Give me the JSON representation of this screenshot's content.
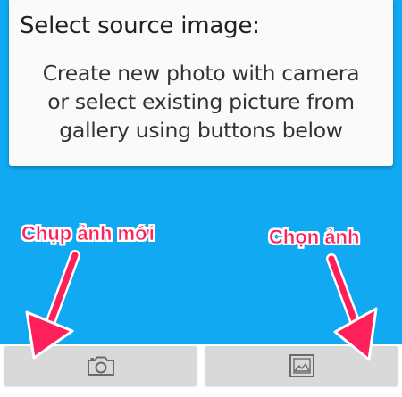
{
  "card": {
    "title": "Select source image:",
    "body_lines": [
      "Create new photo with camera",
      "or select existing picture from",
      "gallery using buttons below"
    ]
  },
  "annotations": {
    "camera_label": "Chụp ảnh mới",
    "gallery_label": "Chọn ảnh"
  },
  "buttons": {
    "camera": {
      "icon": "camera-icon"
    },
    "gallery": {
      "icon": "image-icon"
    }
  },
  "colors": {
    "background": "#10a9f2",
    "annotation": "#ff1f5a",
    "button": "#d9d9d9",
    "card": "#fafafa"
  }
}
